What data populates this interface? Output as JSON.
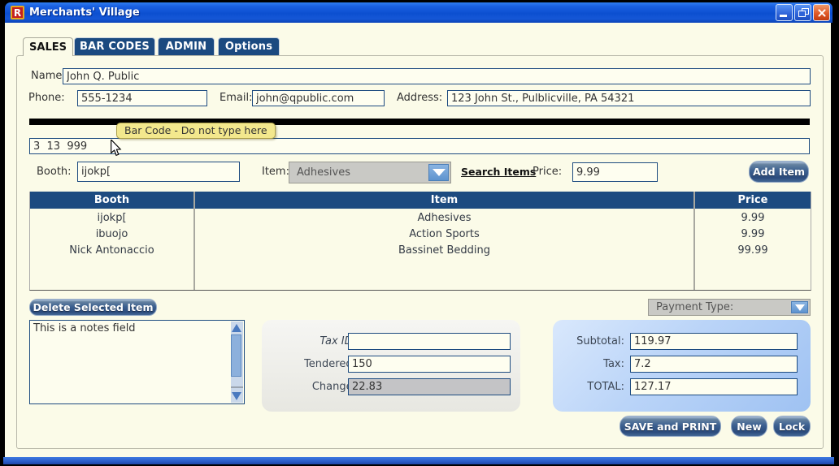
{
  "window": {
    "title": "Merchants' Village",
    "icon_letter": "R"
  },
  "tabs": [
    {
      "label": "SALES",
      "active": true
    },
    {
      "label": "BAR CODES",
      "active": false
    },
    {
      "label": "ADMIN",
      "active": false
    },
    {
      "label": "Options",
      "active": false
    }
  ],
  "customer": {
    "name_label": "Name:",
    "name_value": "John Q. Public",
    "phone_label": "Phone:",
    "phone_value": "555-1234",
    "email_label": "Email:",
    "email_value": "john@qpublic.com",
    "address_label": "Address:",
    "address_value": "123 John St., Pulblicville, PA 54321"
  },
  "barcode": {
    "tooltip": "Bar Code - Do not type here",
    "value": "3  13  999"
  },
  "item_entry": {
    "booth_label": "Booth:",
    "booth_value": "ijokp[",
    "item_label": "Item:",
    "item_selected": "Adhesives",
    "search_label": "Search Items",
    "price_label": "Price:",
    "price_value": "9.99",
    "add_label": "Add Item"
  },
  "items_table": {
    "headers": [
      "Booth",
      "Item",
      "Price"
    ],
    "rows": [
      {
        "booth": "ijokp[",
        "item": "Adhesives",
        "price": "9.99"
      },
      {
        "booth": "ibuojo",
        "item": "Action Sports",
        "price": "9.99"
      },
      {
        "booth": "Nick Antonaccio",
        "item": "Bassinet Bedding",
        "price": "99.99"
      }
    ]
  },
  "notes": {
    "text": "This is a notes field"
  },
  "payment_panel": {
    "payment_type_label": "Payment Type:",
    "tax_id_label": "Tax ID:",
    "tax_id_value": "",
    "tendered_label": "Tendered:",
    "tendered_value": "150",
    "change_label": "Change:",
    "change_value": "22.83"
  },
  "totals_panel": {
    "subtotal_label": "Subtotal:",
    "subtotal_value": "119.97",
    "tax_label": "Tax:",
    "tax_value": "7.2",
    "total_label": "TOTAL:",
    "total_value": "127.17"
  },
  "actions": {
    "delete_label": "Delete Selected Item",
    "save_print_label": "SAVE and PRINT",
    "new_label": "New",
    "lock_label": "Lock"
  },
  "colors": {
    "navy": "#1d4b80",
    "titlebar_blue": "#1557D6",
    "client_cream": "#FBFBE8",
    "tooltip_yellow": "#F3E88D",
    "dropdown_gray": "#C9C9C5"
  }
}
